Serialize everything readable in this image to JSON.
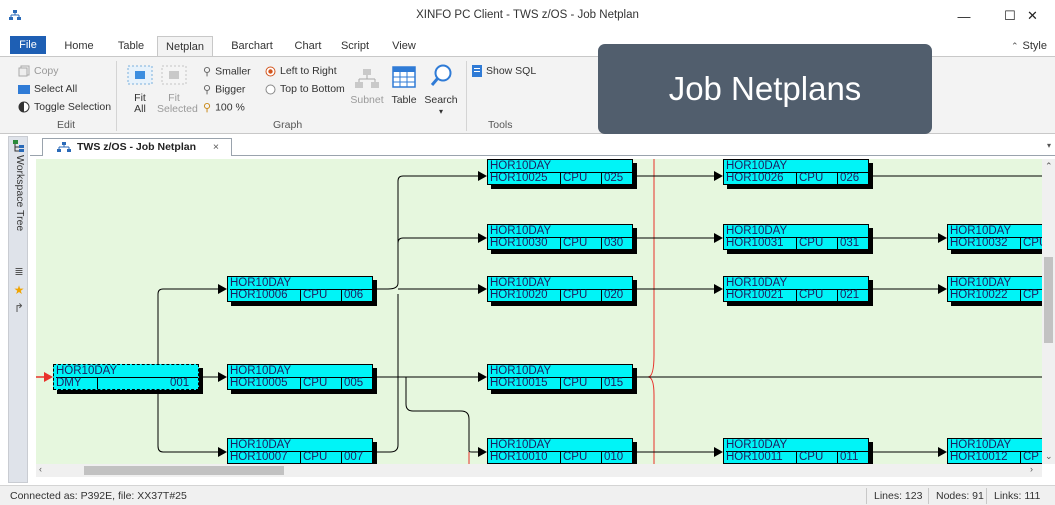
{
  "window": {
    "title": "XINFO PC Client - TWS z/OS - Job Netplan",
    "minimize": "—",
    "maximize": "☐",
    "close": "✕"
  },
  "ribbon_tabs": [
    "File",
    "Home",
    "Table",
    "Netplan",
    "Barchart",
    "Chart",
    "Script",
    "View"
  ],
  "active_tab": "Netplan",
  "style_menu": "Style",
  "ribbon": {
    "edit": {
      "copy": "Copy",
      "select_all": "Select All",
      "toggle_selection": "Toggle Selection",
      "group_label": "Edit"
    },
    "graph": {
      "fit_all": "Fit\nAll",
      "fit_selected": "Fit\nSelected",
      "smaller": "Smaller",
      "bigger": "Bigger",
      "zoom": "100 %",
      "left_to_right": "Left to Right",
      "top_to_bottom": "Top to Bottom",
      "subnet": "Subnet",
      "table": "Table",
      "search": "Search",
      "group_label": "Graph"
    },
    "tools": {
      "show_sql": "Show SQL",
      "group_label": "Tools"
    }
  },
  "overlay_caption": "Job Netplans",
  "left_dock": {
    "workspace_tree": "Workspace Tree"
  },
  "document_tab": {
    "label": "TWS z/OS - Job Netplan",
    "close": "×"
  },
  "colors": {
    "node_fill": "#00f4f7",
    "canvas_bg": "#e6f7de",
    "file_tab": "#1e5fb4",
    "overlay_bg": "#515e6d",
    "critical_line": "#e8322b"
  },
  "nodes": [
    {
      "id": "root",
      "app": "HOR10DAY",
      "job": "DMY",
      "ws": "",
      "op": "001",
      "dashed": true
    },
    {
      "id": "n006",
      "app": "HOR10DAY",
      "job": "HOR10006",
      "ws": "CPU",
      "op": "006"
    },
    {
      "id": "n005",
      "app": "HOR10DAY",
      "job": "HOR10005",
      "ws": "CPU",
      "op": "005"
    },
    {
      "id": "n007",
      "app": "HOR10DAY",
      "job": "HOR10007",
      "ws": "CPU",
      "op": "007"
    },
    {
      "id": "n025",
      "app": "HOR10DAY",
      "job": "HOR10025",
      "ws": "CPU",
      "op": "025"
    },
    {
      "id": "n030",
      "app": "HOR10DAY",
      "job": "HOR10030",
      "ws": "CPU",
      "op": "030"
    },
    {
      "id": "n020",
      "app": "HOR10DAY",
      "job": "HOR10020",
      "ws": "CPU",
      "op": "020"
    },
    {
      "id": "n015",
      "app": "HOR10DAY",
      "job": "HOR10015",
      "ws": "CPU",
      "op": "015"
    },
    {
      "id": "n010",
      "app": "HOR10DAY",
      "job": "HOR10010",
      "ws": "CPU",
      "op": "010"
    },
    {
      "id": "n026",
      "app": "HOR10DAY",
      "job": "HOR10026",
      "ws": "CPU",
      "op": "026"
    },
    {
      "id": "n031",
      "app": "HOR10DAY",
      "job": "HOR10031",
      "ws": "CPU",
      "op": "031"
    },
    {
      "id": "n021",
      "app": "HOR10DAY",
      "job": "HOR10021",
      "ws": "CPU",
      "op": "021"
    },
    {
      "id": "n011",
      "app": "HOR10DAY",
      "job": "HOR10011",
      "ws": "CPU",
      "op": "011"
    },
    {
      "id": "n032",
      "app": "HOR10DAY",
      "job": "HOR10032",
      "ws": "CPU",
      "op": ""
    },
    {
      "id": "n022",
      "app": "HOR10DAY",
      "job": "HOR10022",
      "ws": "CP",
      "op": ""
    },
    {
      "id": "n012",
      "app": "HOR10DAY",
      "job": "HOR10012",
      "ws": "CP",
      "op": ""
    }
  ],
  "status": {
    "connection": "Connected as: P392E, file: XX37T#25",
    "lines": "Lines: 123",
    "nodes": "Nodes: 91",
    "links": "Links: 111"
  }
}
